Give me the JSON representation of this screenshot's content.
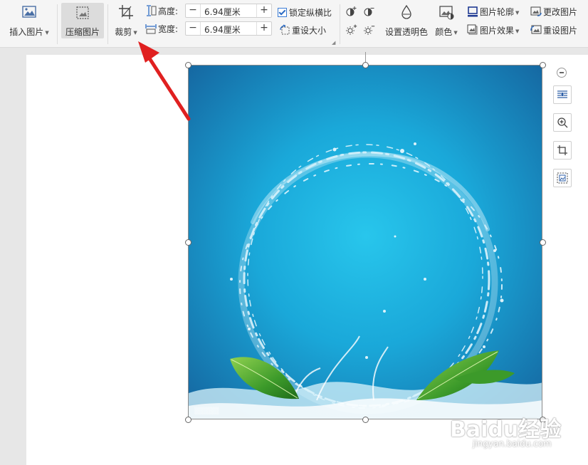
{
  "toolbar": {
    "insert_picture": "插入图片",
    "compress_picture": "压缩图片",
    "crop": "裁剪",
    "height_label": "高度:",
    "width_label": "宽度:",
    "height_value": "6.94厘米",
    "width_value": "6.94厘米",
    "lock_aspect": "锁定纵横比",
    "reset_size": "重设大小",
    "set_transparent": "设置透明色",
    "color": "颜色",
    "picture_outline": "图片轮廓",
    "picture_effects": "图片效果",
    "change_picture": "更改图片",
    "reset_picture": "重设图片"
  },
  "watermark": {
    "brand": "Baidu经验",
    "url": "jingyan.baidu.com"
  },
  "colors": {
    "arrow": "#e02020",
    "sky_top": "#1f86c4",
    "sky_center": "#22c3ea"
  }
}
